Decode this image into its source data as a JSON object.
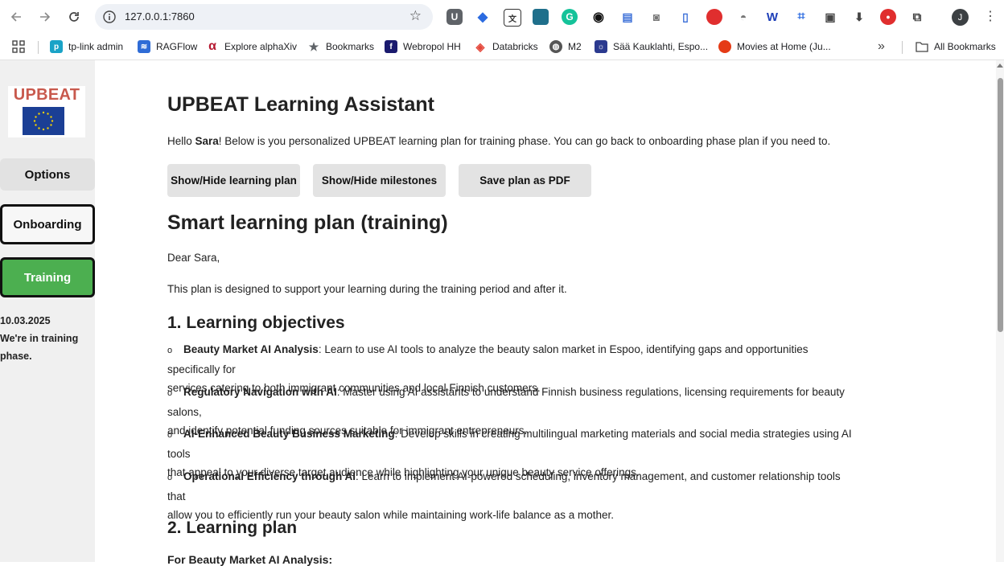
{
  "browser": {
    "url": "127.0.0.1:7860",
    "avatar_letter": "J",
    "extension_icons": [
      "ublock-icon",
      "diamond-icon",
      "translate-icon",
      "square-icon",
      "grammarly-icon",
      "eye-icon",
      "print-icon",
      "camera-icon",
      "capsule-icon",
      "half-circle-icon",
      "monkey-icon",
      "w-icon",
      "crop-icon",
      "capture-icon",
      "download-icon",
      "pdf-icon",
      "puzzle-icon"
    ],
    "bookmarks": [
      {
        "label": "tp-link admin",
        "icon": "tplink-icon",
        "color": "#1aa3c7"
      },
      {
        "label": "RAGFlow",
        "icon": "ragflow-icon",
        "color": "#2f6cd6"
      },
      {
        "label": "Explore alphaXiv",
        "icon": "alpha-icon",
        "color": "#b5172f"
      },
      {
        "label": "Bookmarks",
        "icon": "star-icon",
        "color": "#5f6368"
      },
      {
        "label": "Webropol HH",
        "icon": "webropol-icon",
        "color": "#1a1a6e"
      },
      {
        "label": "Databricks",
        "icon": "databricks-icon",
        "color": "#e4473a"
      },
      {
        "label": "M2",
        "icon": "globe-icon",
        "color": "#555555"
      },
      {
        "label": "Sää Kauklahti, Espo...",
        "icon": "weather-icon",
        "color": "#2b3a8f"
      },
      {
        "label": "Movies at Home (Ju...",
        "icon": "tomato-icon",
        "color": "#e53b16"
      }
    ],
    "overflow": "»",
    "all_bookmarks": "All Bookmarks"
  },
  "sidebar": {
    "logo_text": "UPBEAT",
    "options_label": "Options",
    "onboarding_label": "Onboarding",
    "training_label": "Training",
    "date": "10.03.2025",
    "phase_line1": "We're in training",
    "phase_line2": "phase."
  },
  "main": {
    "title": "UPBEAT Learning Assistant",
    "hello_prefix": "Hello ",
    "hello_name": "Sara",
    "hello_suffix": "! Below is you personalized UPBEAT learning plan for training phase. You can go back to onboarding phase plan if you need to.",
    "buttons": {
      "toggle_plan": "Show/Hide learning plan",
      "toggle_milestones": "Show/Hide milestones",
      "save_pdf": "Save plan as PDF"
    },
    "plan_title": "Smart learning plan (training)",
    "greeting": "Dear Sara,",
    "intro": "This plan is designed to support your learning during the training period and after it.",
    "section1": "1. Learning objectives",
    "objectives": [
      {
        "title": "Beauty Market AI Analysis",
        "line1": ": Learn to use AI tools to analyze the beauty salon market in Espoo, identifying gaps and opportunities specifically for",
        "line2": "services catering to both immigrant communities and local Finnish customers."
      },
      {
        "title": "Regulatory Navigation with AI",
        "line1": ": Master using AI assistants to understand Finnish business regulations, licensing requirements for beauty salons,",
        "line2": "and identify potential funding sources suitable for immigrant entrepreneurs."
      },
      {
        "title": "AI-Enhanced Beauty Business Marketing",
        "line1": ": Develop skills in creating multilingual marketing materials and social media strategies using AI tools",
        "line2": "that appeal to your diverse target audience while highlighting your unique beauty service offerings."
      },
      {
        "title": "Operational Efficiency through AI",
        "line1": ": Learn to implement AI-powered scheduling, inventory management, and customer relationship tools that",
        "line2": "allow you to efficiently run your beauty salon while maintaining work-life balance as a mother."
      }
    ],
    "bullet": "o",
    "section2": "2. Learning plan",
    "subsection": "For Beauty Market AI Analysis:"
  }
}
